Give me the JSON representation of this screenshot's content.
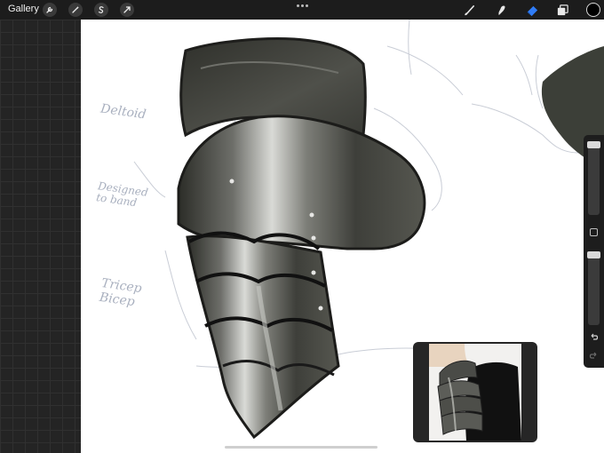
{
  "app": {
    "gallery_label": "Gallery"
  },
  "toolbar": {
    "left_tools": [
      {
        "name": "actions",
        "icon": "wrench-icon"
      },
      {
        "name": "adjustments",
        "icon": "magic-wand-icon"
      },
      {
        "name": "selection",
        "icon": "selection-s-icon"
      },
      {
        "name": "transform",
        "icon": "transform-arrow-icon"
      }
    ],
    "right_tools": [
      {
        "name": "brush",
        "icon": "brush-icon"
      },
      {
        "name": "smudge",
        "icon": "smudge-icon"
      },
      {
        "name": "eraser",
        "icon": "eraser-icon",
        "active": true
      },
      {
        "name": "layers",
        "icon": "layers-icon"
      }
    ],
    "active_tool_color": "#2f7cf6",
    "current_color": "#000000"
  },
  "canvas": {
    "sketch_notes": [
      "Deltoid",
      "Designed\nto band",
      "Tricep\nBicep"
    ]
  },
  "reference": {
    "description_icon": "reference-photo"
  }
}
